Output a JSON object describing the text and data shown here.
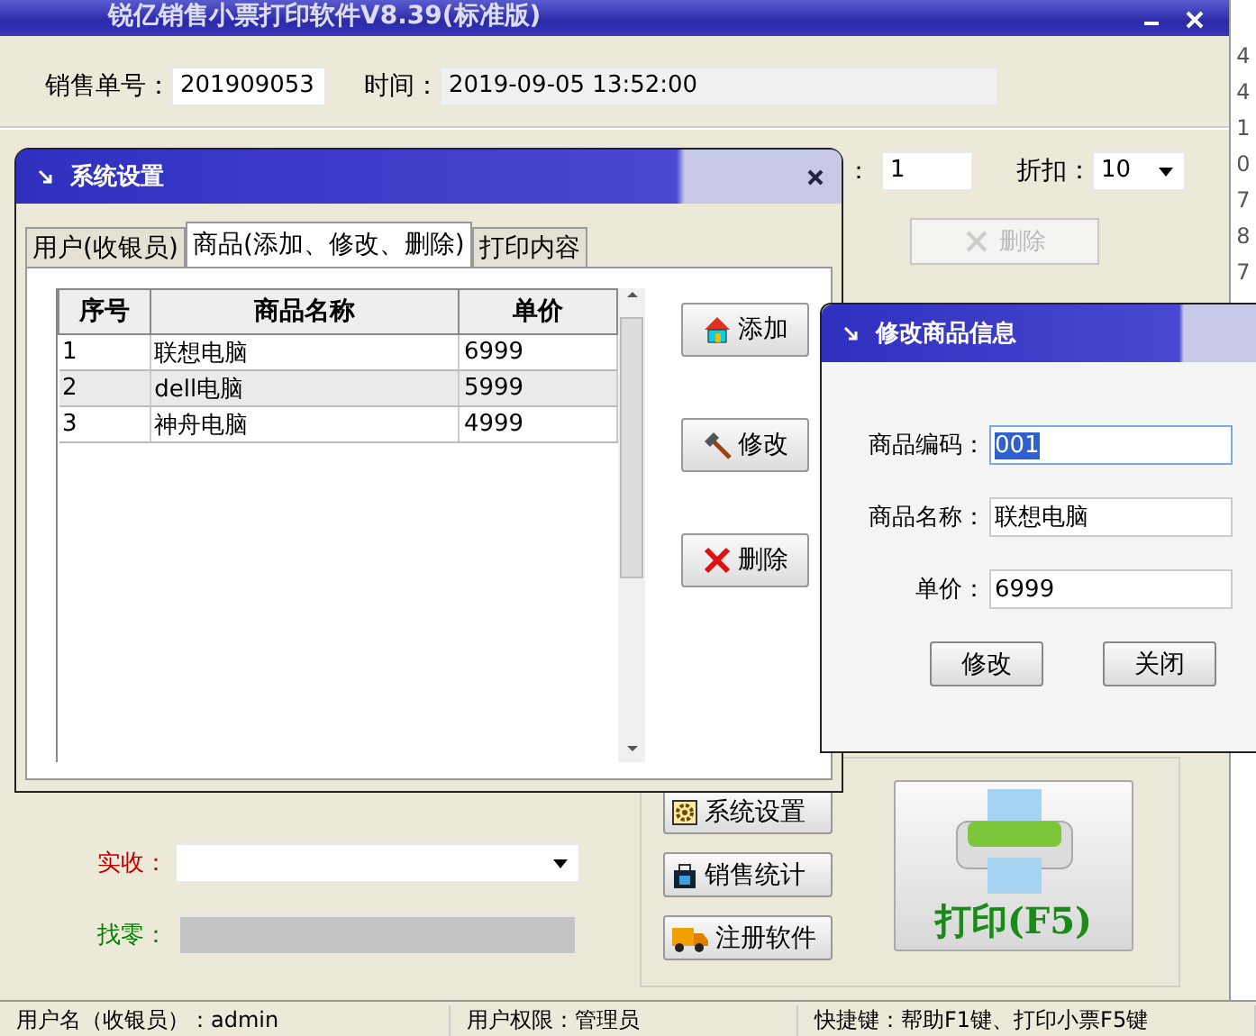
{
  "main_window": {
    "title": "锐亿销售小票打印软件V8.39(标准版)"
  },
  "order_no": {
    "label": "销售单号：",
    "value": "201909053"
  },
  "time": {
    "label": "时间：",
    "value": "2019-09-05 13:52:00"
  },
  "quantity": {
    "label": "：",
    "value": "1"
  },
  "discount": {
    "label": "折扣：",
    "value": "10"
  },
  "delete_button": {
    "label": "删除",
    "disabled": true
  },
  "received": {
    "label": "实收："
  },
  "change": {
    "label": "找零："
  },
  "side_buttons": [
    {
      "label": "系统设置",
      "kind": "settings"
    },
    {
      "label": "销售统计",
      "kind": "stats"
    },
    {
      "label": "注册软件",
      "kind": "register"
    }
  ],
  "print_button": {
    "label": "打印(F5)"
  },
  "edge_digits": [
    "4",
    "4",
    "1",
    "0",
    "7",
    "8",
    "7"
  ],
  "status_bar": [
    "用户名（收银员）：admin",
    "用户权限：管理员",
    "快捷键：帮助F1键、打印小票F5键"
  ],
  "settings_dialog": {
    "title": "系统设置",
    "tabs": [
      {
        "label": "用户(收银员)",
        "selected": false
      },
      {
        "label": "商品(添加、修改、删除)",
        "selected": true
      },
      {
        "label": "打印内容",
        "selected": false
      }
    ],
    "columns": [
      "序号",
      "商品名称",
      "单价"
    ],
    "rows": [
      [
        "1",
        "联想电脑",
        "6999"
      ],
      [
        "2",
        "dell电脑",
        "5999"
      ],
      [
        "3",
        "神舟电脑",
        "4999"
      ]
    ],
    "buttons": [
      {
        "label": "添加",
        "kind": "add"
      },
      {
        "label": "修改",
        "kind": "edit"
      },
      {
        "label": "删除",
        "kind": "delete"
      }
    ]
  },
  "edit_dialog": {
    "title": "修改商品信息",
    "fields": [
      {
        "label": "商品编码：",
        "value": "001",
        "selected": true
      },
      {
        "label": "商品名称：",
        "value": "联想电脑",
        "selected": false
      },
      {
        "label": "单价：",
        "value": "6999",
        "selected": false
      }
    ],
    "buttons": [
      "修改",
      "关闭"
    ]
  }
}
